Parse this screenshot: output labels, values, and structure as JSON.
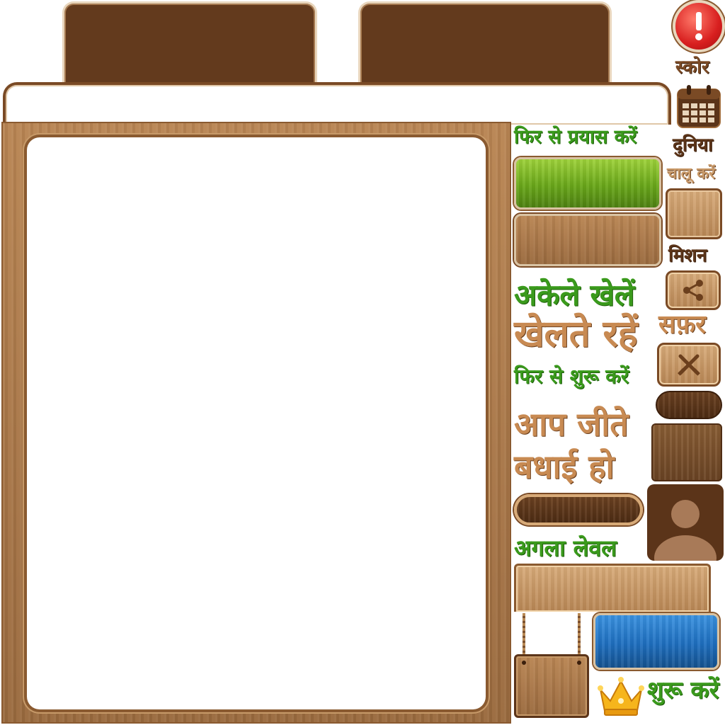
{
  "labels": {
    "score": "स्कोर",
    "world": "दुनिया",
    "retry": "फिर से प्रयास करें",
    "resume": "चालू करें",
    "mission": "मिशन",
    "play_solo": "अकेले खेलें",
    "journey": "सफ़र",
    "keep_playing": "खेलते रहें",
    "restart": "फिर से शुरू करें",
    "you_won": "आप जीते",
    "congratulations": "बधाई हो",
    "next_level": "अगला लेवल",
    "start": "शुरू करें"
  },
  "icons": {
    "alert": "exclamation-icon",
    "calendar": "calendar-icon",
    "share": "share-icon",
    "battle": "crossed-swords-icon",
    "avatar": "user-avatar-icon",
    "crown": "crown-icon"
  },
  "colors": {
    "dark_brown": "#633a1d",
    "wood": "#a87445",
    "green_text": "#3a9a1c",
    "alert_red": "#d81f1f",
    "blue_button": "#1e6fc0",
    "green_button": "#6aa81a"
  }
}
